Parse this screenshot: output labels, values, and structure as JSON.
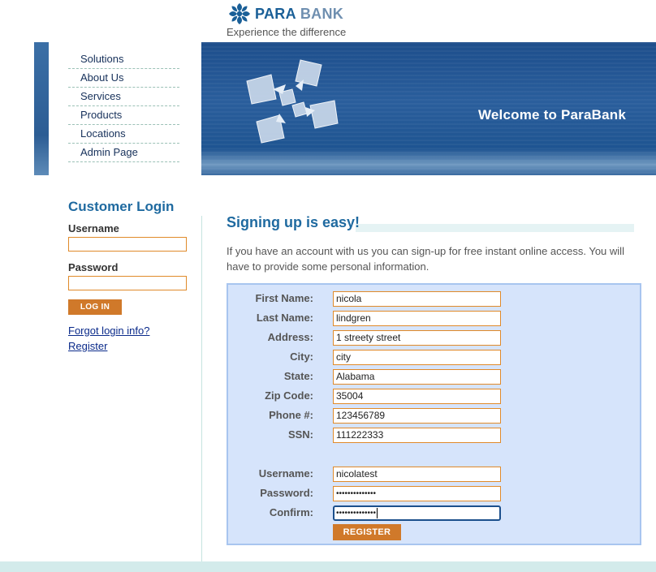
{
  "header": {
    "logo_para": "PARA",
    "logo_bank": "BANK",
    "tagline": "Experience the difference",
    "brand_color": "#1a5f97"
  },
  "menu": {
    "items": [
      {
        "label": "Solutions"
      },
      {
        "label": "About Us"
      },
      {
        "label": "Services"
      },
      {
        "label": "Products"
      },
      {
        "label": "Locations"
      },
      {
        "label": "Admin Page"
      }
    ]
  },
  "banner": {
    "welcome": "Welcome to ParaBank"
  },
  "login": {
    "title": "Customer Login",
    "username_label": "Username",
    "password_label": "Password",
    "username_value": "",
    "password_value": "",
    "login_button": "LOG IN",
    "forgot_link": "Forgot login info?",
    "register_link": "Register"
  },
  "main": {
    "title": "Signing up is easy!",
    "intro": "If you have an account with us you can sign-up for free instant online access. You will have to provide some personal information."
  },
  "form": {
    "fields": [
      {
        "label": "First Name:",
        "value": "nicola"
      },
      {
        "label": "Last Name:",
        "value": "lindgren"
      },
      {
        "label": "Address:",
        "value": "1 streety street"
      },
      {
        "label": "City:",
        "value": "city"
      },
      {
        "label": "State:",
        "value": "Alabama"
      },
      {
        "label": "Zip Code:",
        "value": "35004"
      },
      {
        "label": "Phone #:",
        "value": "123456789"
      },
      {
        "label": "SSN:",
        "value": "111222333"
      }
    ],
    "account": [
      {
        "label": "Username:",
        "value": "nicolatest"
      },
      {
        "label": "Password:",
        "value": "••••••••••••••"
      },
      {
        "label": "Confirm:",
        "value": "••••••••••••••"
      }
    ],
    "register_button": "REGISTER",
    "accent_color": "#d0792a",
    "box_color": "#d6e4fb"
  }
}
